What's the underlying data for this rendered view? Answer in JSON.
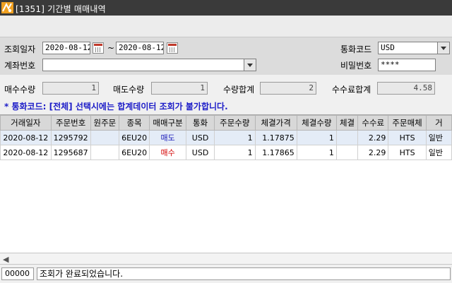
{
  "window": {
    "title": "[1351] 기간별 매매내역",
    "app_icon": "app-logo-icon"
  },
  "filters": {
    "date_label": "조회일자",
    "date_from": "2020-08-12",
    "date_sep": "~",
    "date_to": "2020-08-12",
    "calendar_icon": "calendar-icon",
    "account_label": "계좌번호",
    "account_value": "",
    "currency_label": "통화코드",
    "currency_value": "USD",
    "password_label": "비밀번호",
    "password_value": "****"
  },
  "summary": {
    "buy_qty_label": "매수수량",
    "buy_qty": "1",
    "sell_qty_label": "매도수량",
    "sell_qty": "1",
    "total_qty_label": "수량합계",
    "total_qty": "2",
    "fee_total_label": "수수료합계",
    "fee_total": "4.58"
  },
  "notice": "* 통화코드: [전체] 선택시에는 합계데이터 조회가 불가합니다.",
  "table": {
    "columns": [
      "거래일자",
      "주문번호",
      "원주문",
      "종목",
      "매매구분",
      "통화",
      "주문수량",
      "체결가격",
      "체결수량",
      "체결",
      "수수료",
      "주문매체",
      "거"
    ],
    "rows": [
      {
        "date": "2020-08-12",
        "order_no": "1295792",
        "orig_order": "",
        "symbol": "6EU20",
        "side": "매도",
        "currency": "USD",
        "order_qty": "1",
        "fill_price": "1.17875",
        "fill_qty": "1",
        "fill_extra": "",
        "fee": "2.29",
        "media": "HTS",
        "trade_type": "일반"
      },
      {
        "date": "2020-08-12",
        "order_no": "1295687",
        "orig_order": "",
        "symbol": "6EU20",
        "side": "매수",
        "currency": "USD",
        "order_qty": "1",
        "fill_price": "1.17865",
        "fill_qty": "1",
        "fill_extra": "",
        "fee": "2.29",
        "media": "HTS",
        "trade_type": "일반"
      }
    ]
  },
  "colors": {
    "sell_text": "#1a1ab8",
    "buy_text": "#d40000",
    "notice_text": "#1c1cc8"
  },
  "status": {
    "code": "00000",
    "message": "조회가 완료되었습니다."
  }
}
